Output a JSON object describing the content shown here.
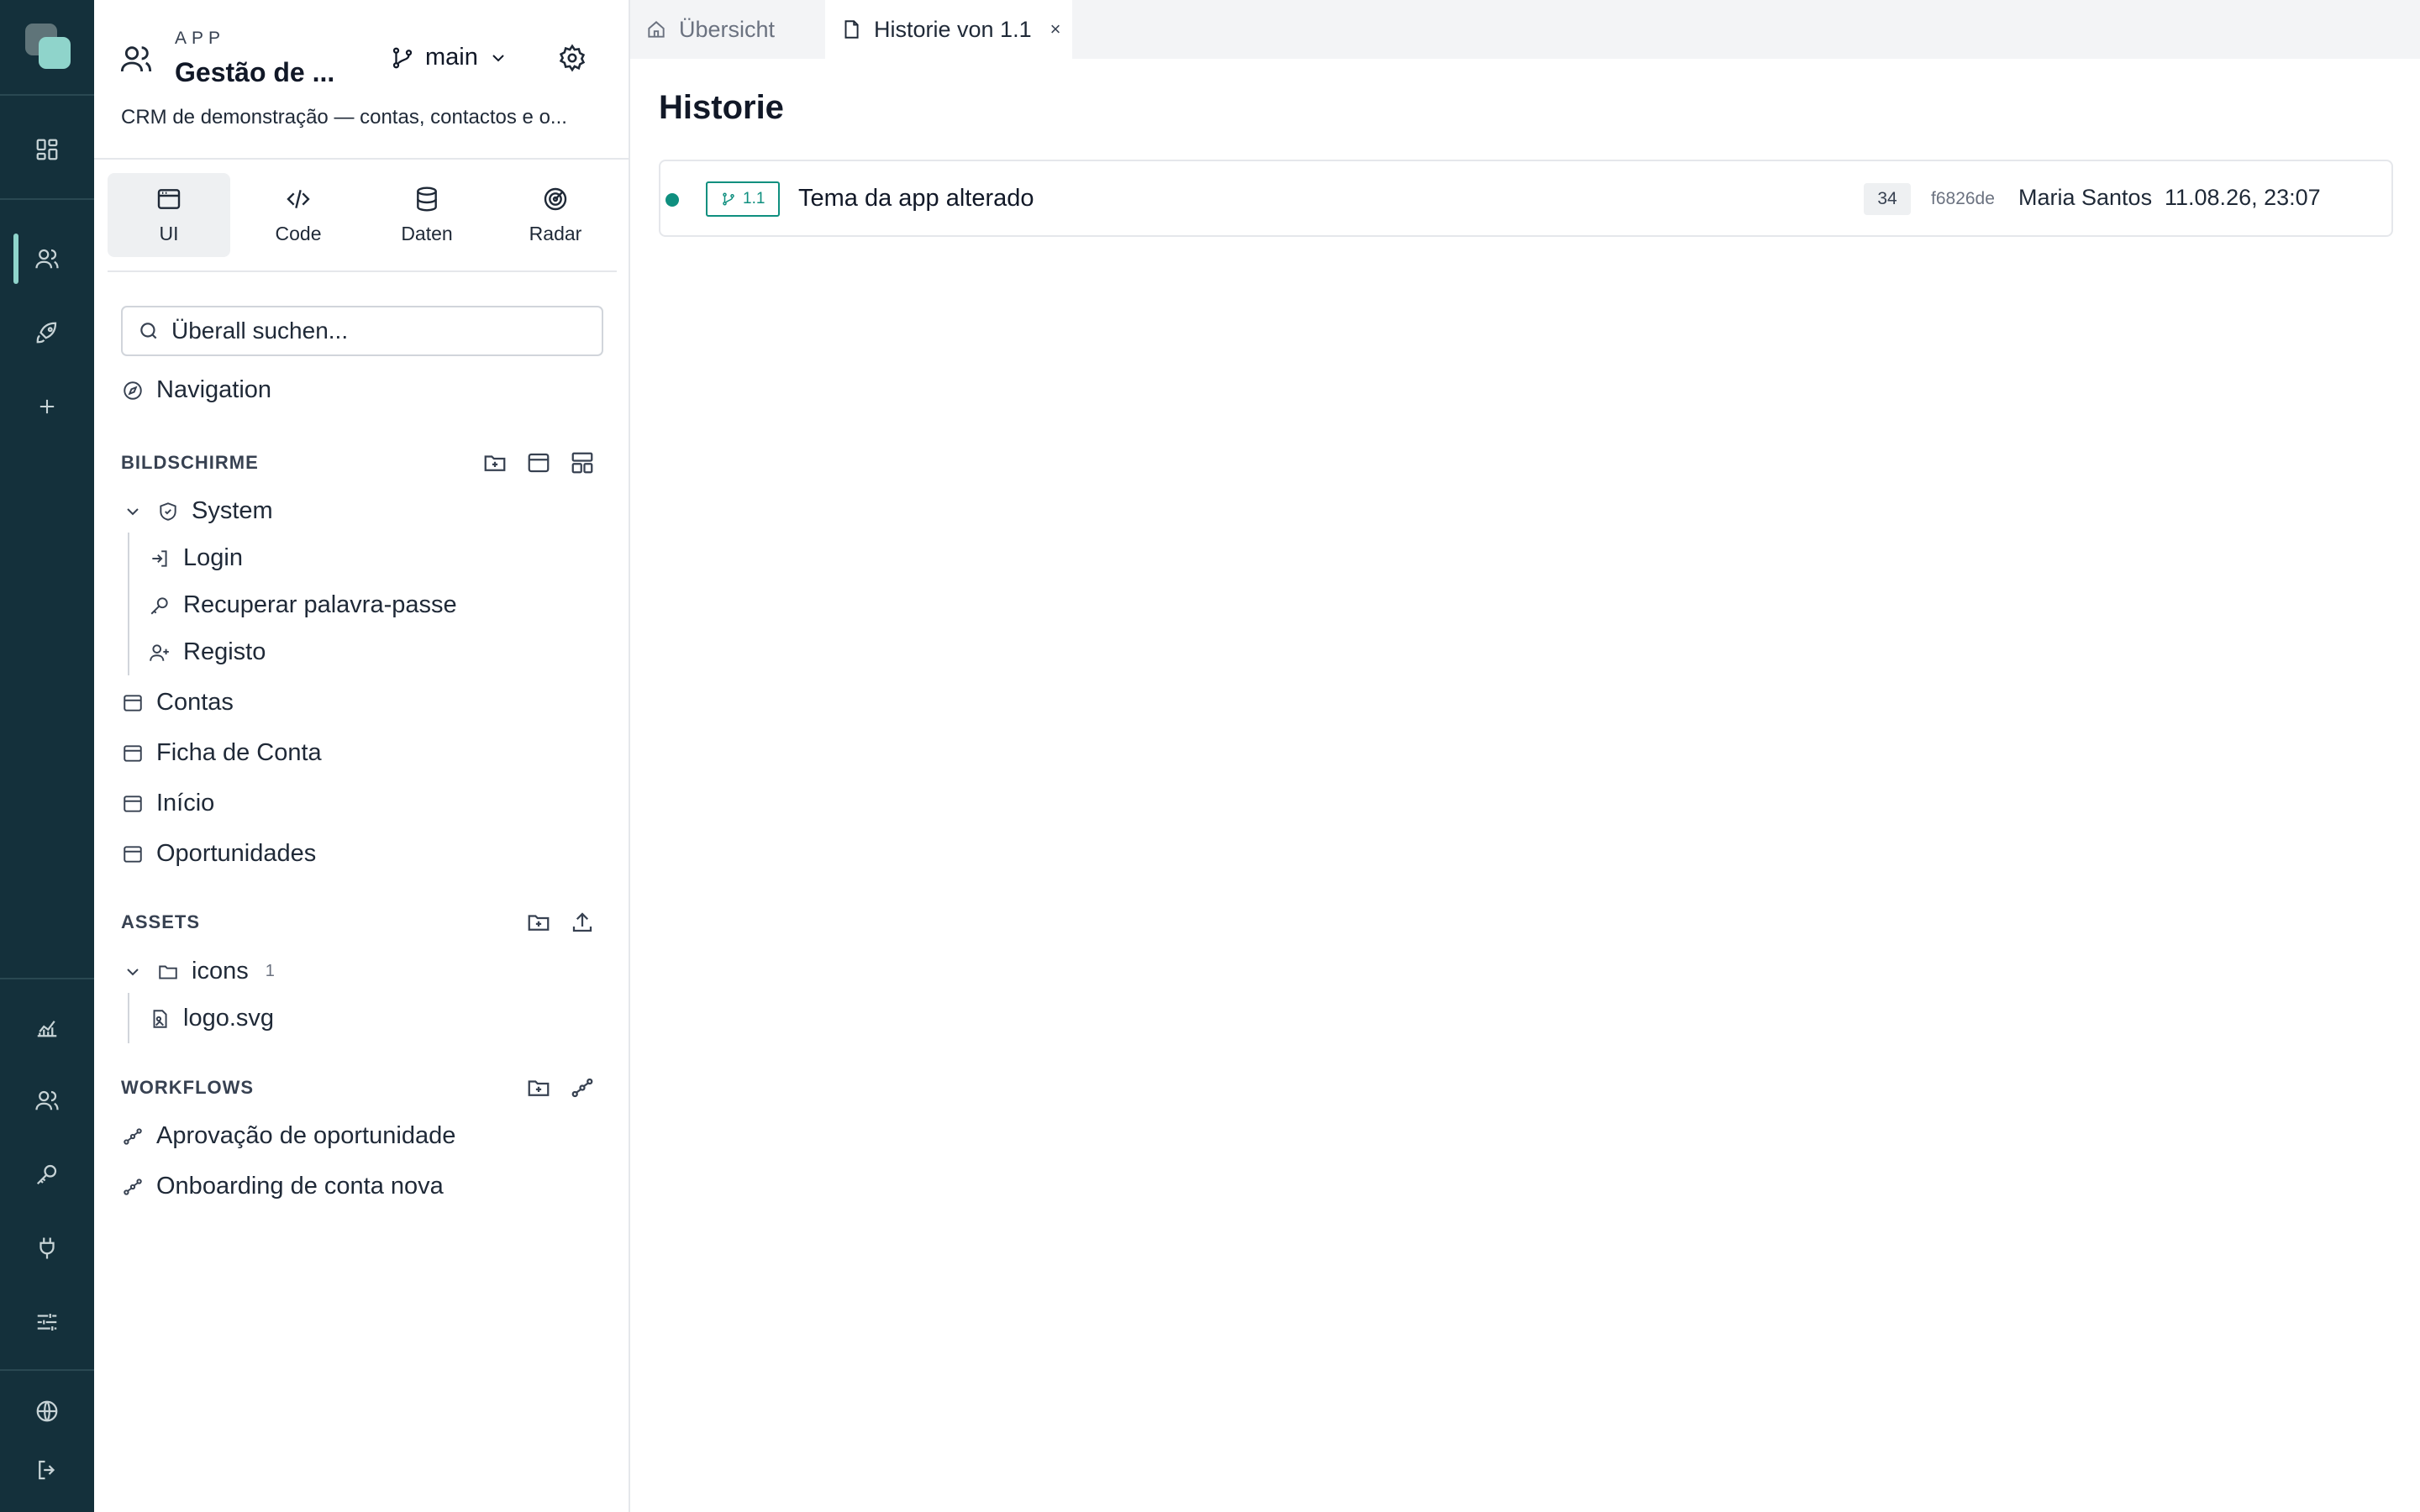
{
  "app": {
    "kicker": "APP",
    "title": "Gestão de ...",
    "description": "CRM de demonstração — contas, contactos e o...",
    "branch": "main"
  },
  "modes": [
    {
      "label": "UI",
      "icon": "window-icon"
    },
    {
      "label": "Code",
      "icon": "code-icon"
    },
    {
      "label": "Daten",
      "icon": "database-icon"
    },
    {
      "label": "Radar",
      "icon": "radar-icon"
    }
  ],
  "search": {
    "placeholder": "Überall suchen..."
  },
  "navigation_label": "Navigation",
  "sections": {
    "screens": {
      "title": "BILDSCHIRME",
      "system_group": "System",
      "system_children": [
        "Login",
        "Recuperar palavra-passe",
        "Registo"
      ],
      "items": [
        "Contas",
        "Ficha de Conta",
        "Início",
        "Oportunidades"
      ]
    },
    "assets": {
      "title": "ASSETS",
      "folder": "icons",
      "folder_count": "1",
      "files": [
        "logo.svg"
      ]
    },
    "workflows": {
      "title": "WORKFLOWS",
      "items": [
        "Aprovação de oportunidade",
        "Onboarding de conta nova"
      ]
    }
  },
  "tabs": [
    {
      "label": "Übersicht",
      "icon": "home-icon"
    },
    {
      "label": "Historie von 1.1",
      "icon": "file-icon",
      "close": "×"
    }
  ],
  "page": {
    "title": "Historie"
  },
  "history": [
    {
      "version": "1.1",
      "message": "Tema da app alterado",
      "count": "34",
      "hash": "f6826de",
      "user": "Maria Santos",
      "date": "11.08.26, 23:07"
    }
  ],
  "colors": {
    "rail_bg": "#14303b",
    "accent": "#0f8f7f",
    "accent_light": "#8fd4cb"
  }
}
